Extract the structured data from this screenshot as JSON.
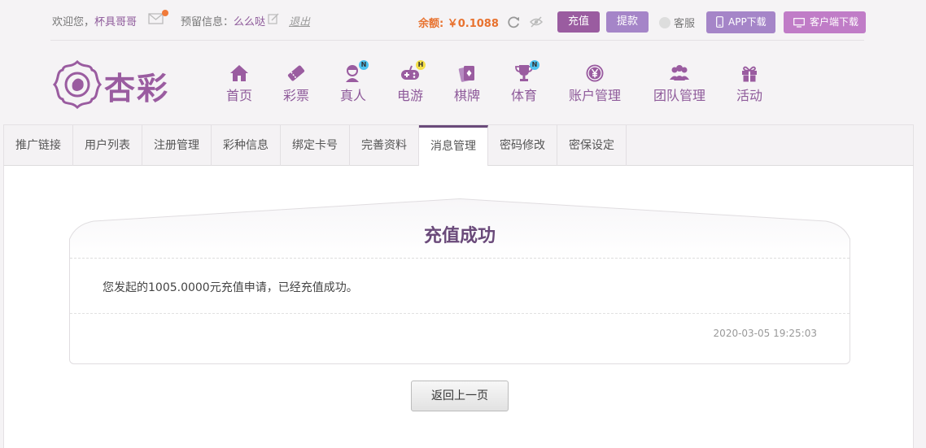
{
  "topbar": {
    "welcome_prefix": "欢迎您，",
    "username": "杯具哥哥",
    "reserve_label": "预留信息：",
    "reserve_value": "么么哒",
    "logout_label": "退出",
    "balance_label": "余额: ￥0.1088",
    "recharge_label": "充值",
    "withdraw_label": "提款",
    "service_label": "客服",
    "app_download_label": "APP下载",
    "client_download_label": "客户端下载",
    "colors": {
      "primary": "#9a5ca0",
      "secondary": "#a585c8",
      "client": "#c07cc7",
      "balance": "#e8722f"
    }
  },
  "header": {
    "logo_text": "杏彩",
    "nav": [
      {
        "label": "首页",
        "icon": "home-icon"
      },
      {
        "label": "彩票",
        "icon": "ticket-icon"
      },
      {
        "label": "真人",
        "icon": "dealer-icon",
        "badge": "N"
      },
      {
        "label": "电游",
        "icon": "gamepad-icon",
        "badge": "H"
      },
      {
        "label": "棋牌",
        "icon": "cards-icon"
      },
      {
        "label": "体育",
        "icon": "trophy-icon",
        "badge": "N"
      },
      {
        "label": "账户管理",
        "icon": "yen-coin-icon"
      },
      {
        "label": "团队管理",
        "icon": "team-icon"
      },
      {
        "label": "活动",
        "icon": "gift-icon"
      }
    ]
  },
  "tabs": [
    {
      "label": "推广链接"
    },
    {
      "label": "用户列表"
    },
    {
      "label": "注册管理"
    },
    {
      "label": "彩种信息"
    },
    {
      "label": "绑定卡号"
    },
    {
      "label": "完善资料"
    },
    {
      "label": "消息管理",
      "active": true
    },
    {
      "label": "密码修改"
    },
    {
      "label": "密保设定"
    }
  ],
  "message": {
    "title": "充值成功",
    "body": "您发起的1005.0000元充值申请，已经充值成功。",
    "time": "2020-03-05 19:25:03"
  },
  "back_label": "返回上一页"
}
